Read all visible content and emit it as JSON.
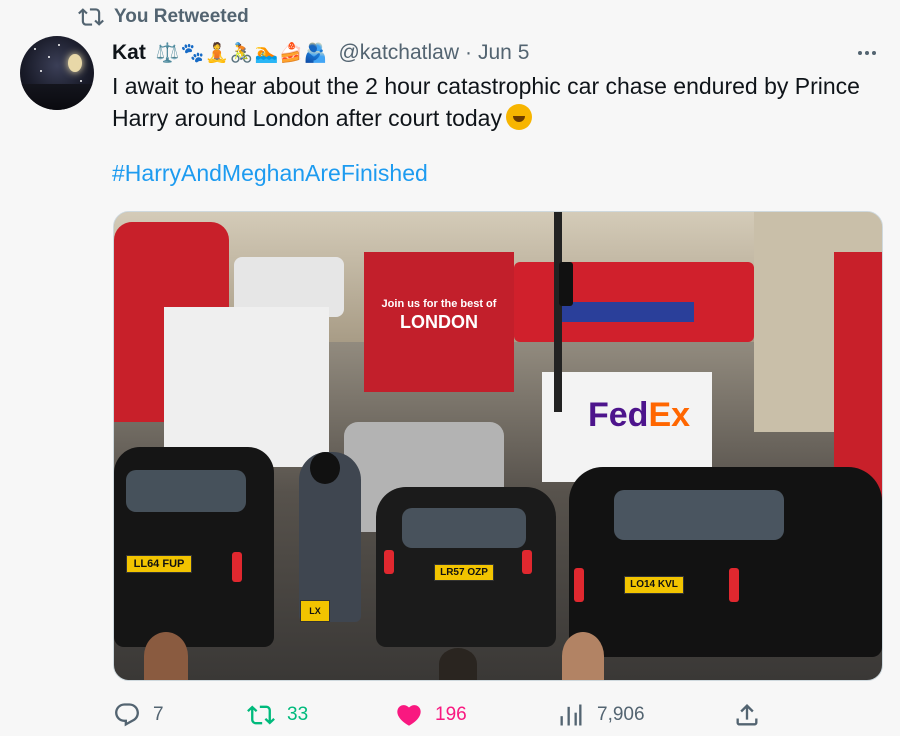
{
  "social_context": {
    "label": "You Retweeted"
  },
  "tweet": {
    "author_name": "Kat",
    "author_emojis": "⚖️🐾🧘🚴🏊🍰🫂",
    "handle": "@katchatlaw",
    "separator": "·",
    "date": "Jun 5",
    "text": "I await to hear about the 2 hour catastrophic car chase endured by Prince Harry around London after court today",
    "hashtag": "#HarryAndMeghanAreFinished"
  },
  "media": {
    "bus_ad_line1": "Join us for the best of",
    "bus_ad_line2": "LONDON",
    "fedex_fe": "Fed",
    "fedex_ex": "Ex",
    "plate_left": "LL64 FUP",
    "plate_center": "LR57 OZP",
    "plate_right": "LO14 KVL",
    "plate_moto": "LX"
  },
  "actions": {
    "replies": "7",
    "retweets": "33",
    "likes": "196",
    "views": "7,906"
  },
  "colors": {
    "accent": "#1d9bf0",
    "retweet": "#00ba7c",
    "like": "#f91880",
    "muted": "#536471"
  }
}
